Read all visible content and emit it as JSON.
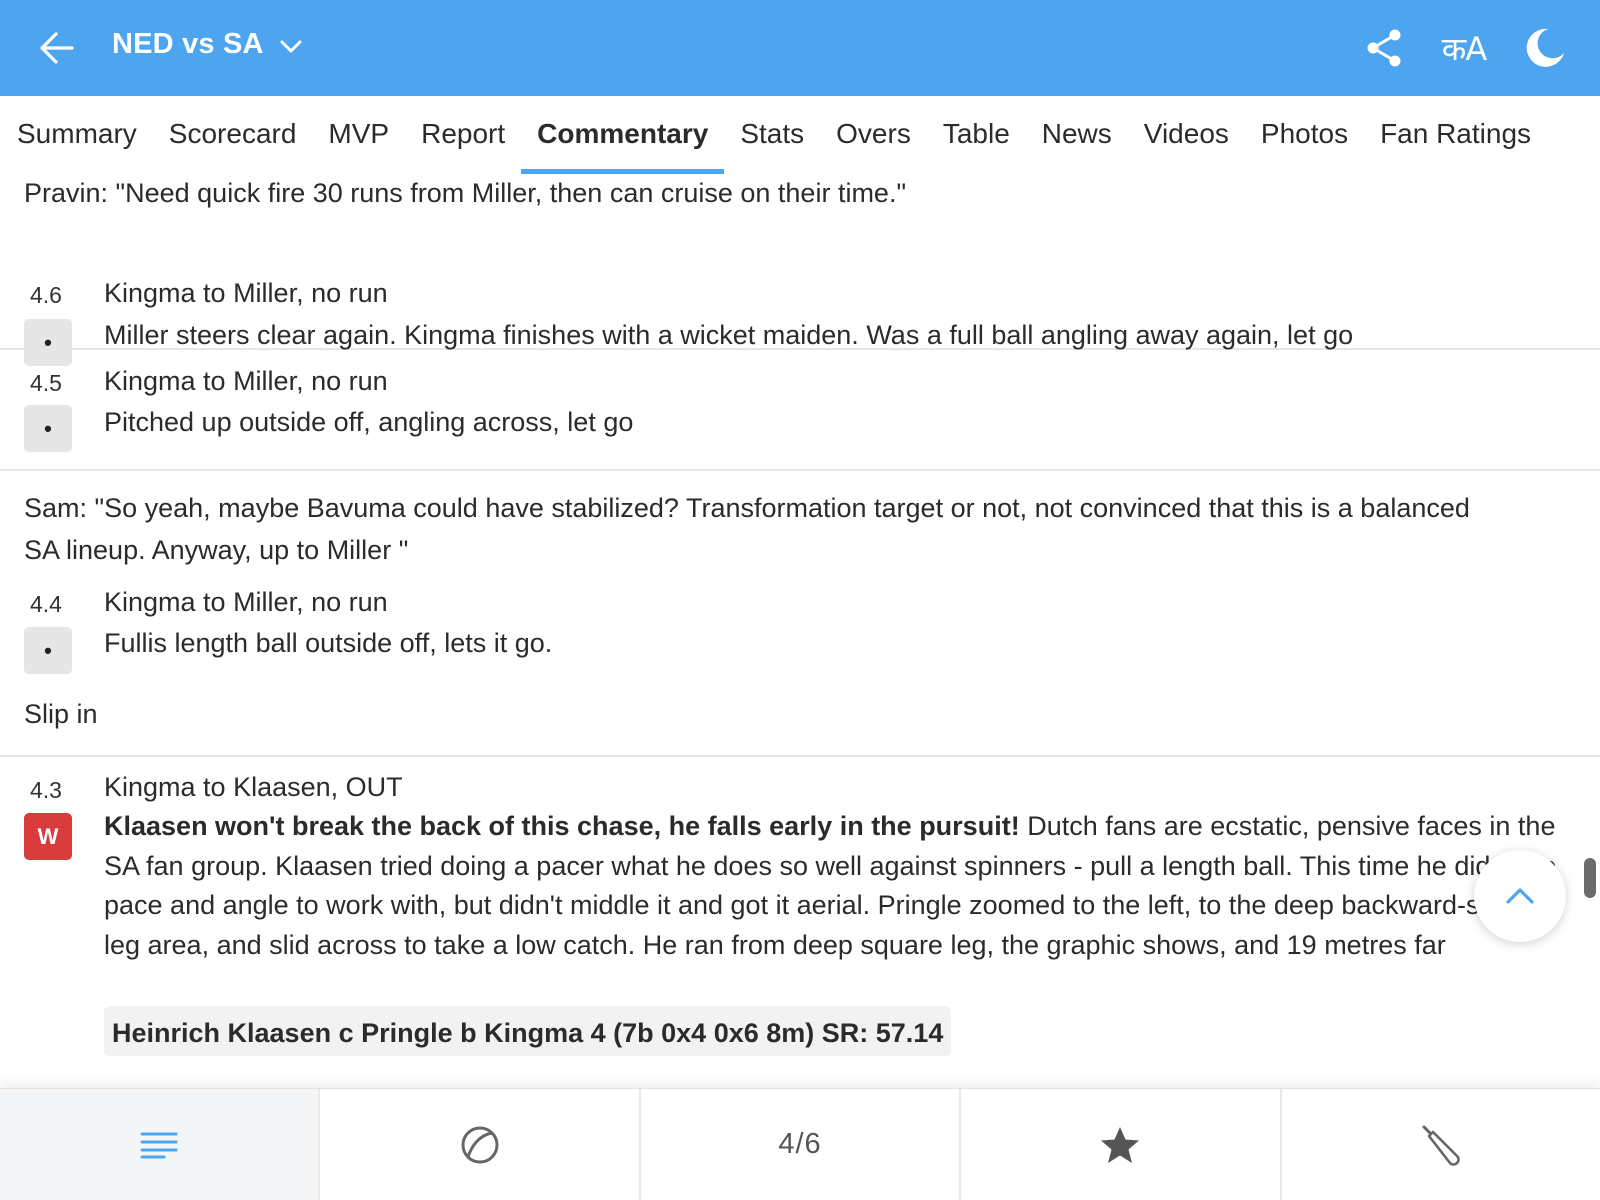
{
  "header": {
    "back_icon": "arrow-left-icon",
    "title": "NED vs SA",
    "title_dropdown_icon": "chevron-down-icon",
    "actions": {
      "share_icon": "share-icon",
      "language_label": "कA",
      "theme_icon": "moon-icon"
    },
    "background_color": "#4ea5ef"
  },
  "tabs": [
    {
      "label": "Summary"
    },
    {
      "label": "Scorecard"
    },
    {
      "label": "MVP"
    },
    {
      "label": "Report"
    },
    {
      "label": "Commentary",
      "active": true
    },
    {
      "label": "Stats"
    },
    {
      "label": "Overs"
    },
    {
      "label": "Table"
    },
    {
      "label": "News"
    },
    {
      "label": "Videos"
    },
    {
      "label": "Photos"
    },
    {
      "label": "Fan Ratings"
    }
  ],
  "feed": {
    "note_top": "Pravin: \"Need quick fire 30 runs from Miller, then can cruise on their time.\"",
    "ball_46": {
      "over": "4.6",
      "badge": "•",
      "title": "Kingma to Miller, no run",
      "text": "Miller steers clear again. Kingma finishes with a wicket maiden. Was a full ball angling away again, let go"
    },
    "ball_45": {
      "over": "4.5",
      "badge": "•",
      "title": "Kingma to Miller, no run",
      "text": "Pitched up outside off, angling across, let go"
    },
    "note_sam": "Sam: \"So yeah, maybe Bavuma could have stabilized? Transformation target or not, not convinced that this is a balanced SA lineup. Anyway, up to Miller \"",
    "ball_44": {
      "over": "4.4",
      "badge": "•",
      "title": "Kingma to Miller, no run",
      "text": "Fullis length ball outside off, lets it go."
    },
    "note_slip": "Slip in",
    "ball_43": {
      "over": "4.3",
      "badge": "W",
      "title": "Kingma to Klaasen, OUT",
      "text_bold": "Klaasen won't break the back of this chase, he falls early in the pursuit!",
      "text": " Dutch fans are ecstatic, pensive faces in the SA fan group. Klaasen tried doing a pacer what he does so well against spinners - pull a length ball. This time he did have pace and angle to work with, but didn't middle it and got it aerial. Pringle zoomed to the left, to the deep backward-square-leg area, and slid across to take a low catch. He ran from deep square leg, the graphic shows, and 19 metres far",
      "dismissal": "Heinrich Klaasen c Pringle b Kingma 4 (7b 0x4 0x6 8m) SR: 57.14"
    }
  },
  "scroll_up_icon": "chevron-up-icon",
  "bottom_nav": {
    "items": [
      {
        "icon": "menu-lines-icon",
        "active": true
      },
      {
        "icon": "cricket-ball-icon"
      },
      {
        "label": "4/6"
      },
      {
        "icon": "star-icon"
      },
      {
        "icon": "cricket-bat-icon"
      }
    ]
  }
}
